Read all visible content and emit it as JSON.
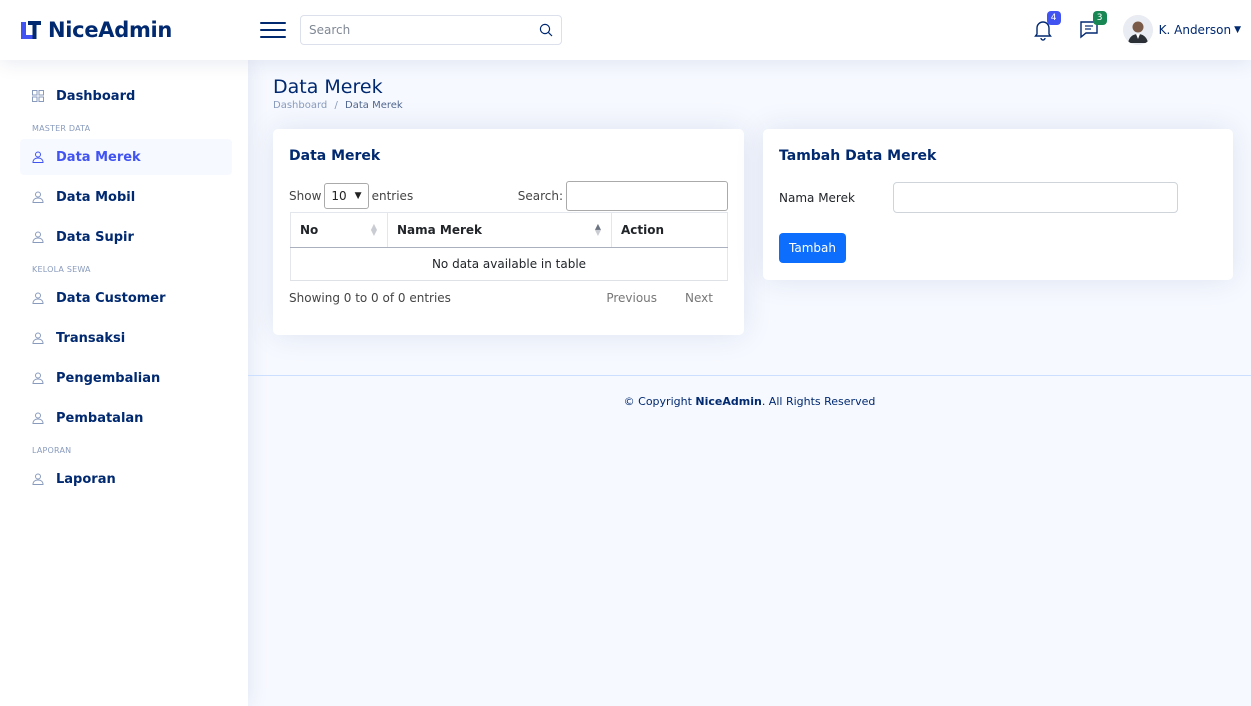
{
  "brand": {
    "name": "NiceAdmin"
  },
  "header": {
    "search_placeholder": "Search",
    "notifications_count": "4",
    "messages_count": "3",
    "user_name": "K. Anderson"
  },
  "sidebar": {
    "dashboard": "Dashboard",
    "heading_master": "MASTER DATA",
    "data_merek": "Data Merek",
    "data_mobil": "Data Mobil",
    "data_supir": "Data Supir",
    "heading_sewa": "KELOLA SEWA",
    "data_customer": "Data Customer",
    "transaksi": "Transaksi",
    "pengembalian": "Pengembalian",
    "pembatalan": "Pembatalan",
    "heading_laporan": "LAPORAN",
    "laporan": "Laporan"
  },
  "page": {
    "title": "Data Merek",
    "breadcrumb_home": "Dashboard",
    "breadcrumb_sep": "/",
    "breadcrumb_current": "Data Merek"
  },
  "table_card": {
    "title": "Data Merek",
    "show_label": "Show",
    "entries_value": "10",
    "entries_label": "entries",
    "search_label": "Search:",
    "columns": [
      "No",
      "Nama Merek",
      "Action"
    ],
    "empty_text": "No data available in table",
    "info": "Showing 0 to 0 of 0 entries",
    "prev": "Previous",
    "next": "Next"
  },
  "form_card": {
    "title": "Tambah Data Merek",
    "field_label": "Nama Merek",
    "field_value": "",
    "submit": "Tambah"
  },
  "footer": {
    "prefix": "© Copyright",
    "brand": "NiceAdmin",
    "suffix": ". All Rights Reserved"
  },
  "colors": {
    "brand_navy": "#012970",
    "accent": "#4154f1",
    "button_primary": "#0d6efd",
    "background": "#f6f9ff"
  },
  "icons": {
    "logo": "logo-mark-icon",
    "menu": "hamburger-icon",
    "search": "search-icon",
    "notifications": "bell-icon",
    "messages": "chat-icon",
    "dashboard": "grid-icon",
    "menu_item": "person-icon"
  }
}
